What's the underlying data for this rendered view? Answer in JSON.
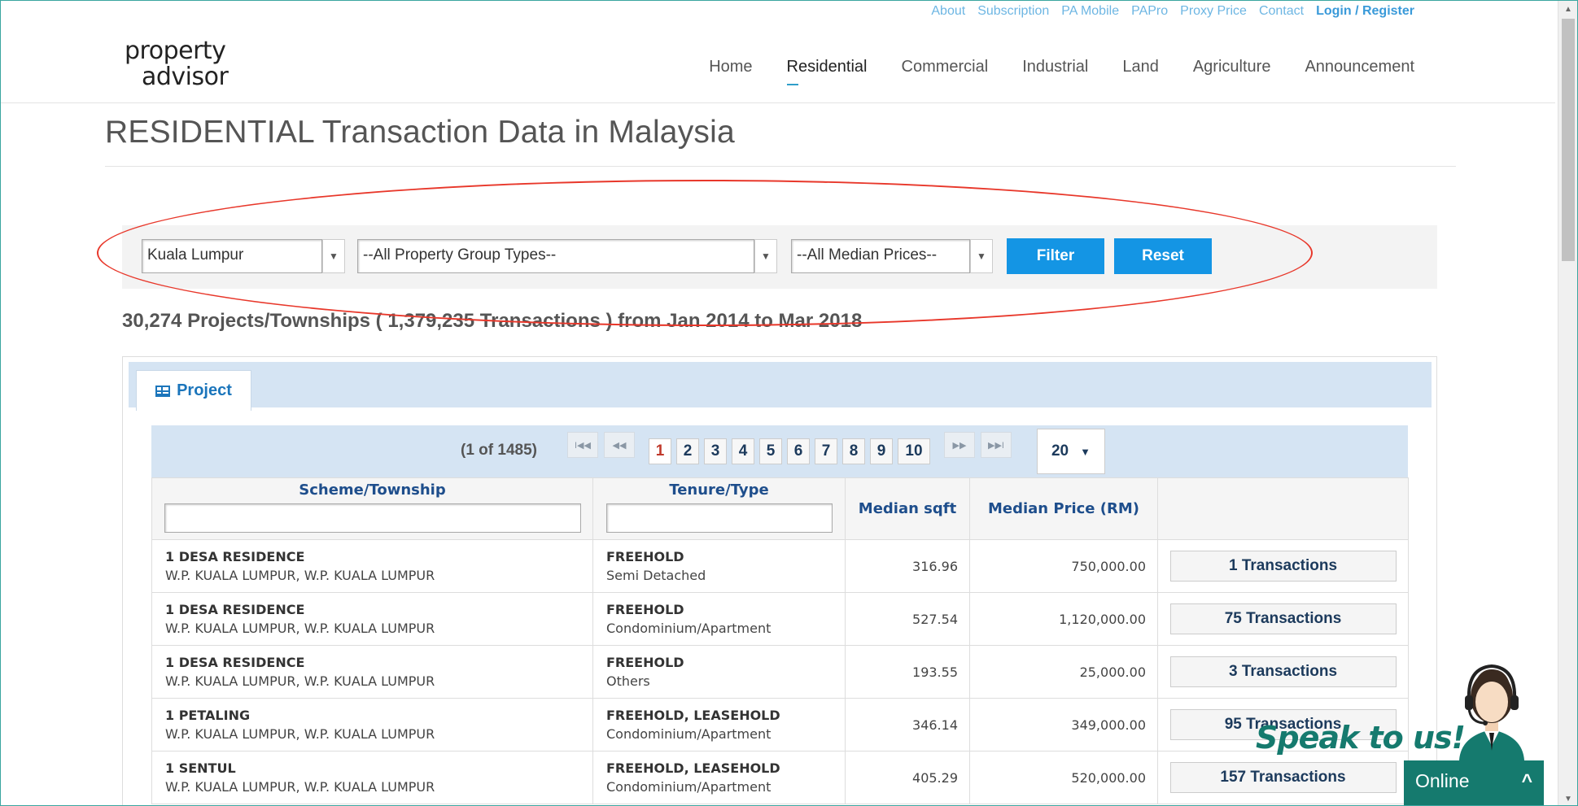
{
  "toplinks": {
    "about": "About",
    "subscription": "Subscription",
    "pa_mobile": "PA Mobile",
    "papro": "PAPro",
    "proxy_price": "Proxy Price",
    "contact": "Contact",
    "login": "Login / Register"
  },
  "logo": {
    "line1": "property",
    "line2": "advisor"
  },
  "nav": {
    "home": "Home",
    "residential": "Residential",
    "commercial": "Commercial",
    "industrial": "Industrial",
    "land": "Land",
    "agriculture": "Agriculture",
    "announcement": "Announcement"
  },
  "page_title": "RESIDENTIAL Transaction Data in Malaysia",
  "filters": {
    "state": "Kuala Lumpur",
    "property_group": "--All Property Group Types--",
    "median_price": "--All Median Prices--",
    "filter_label": "Filter",
    "reset_label": "Reset"
  },
  "summary": "30,274 Projects/Townships ( 1,379,235 Transactions ) from Jan 2014 to Mar 2018",
  "tab": {
    "label": "Project"
  },
  "pager": {
    "info": "(1 of 1485)",
    "first": "I◀◀",
    "prev": "◀◀",
    "next": "▶▶",
    "last": "▶▶I",
    "pages": [
      "1",
      "2",
      "3",
      "4",
      "5",
      "6",
      "7",
      "8",
      "9",
      "10"
    ],
    "current": "1",
    "page_size": "20"
  },
  "columns": {
    "scheme": "Scheme/Township",
    "tenure": "Tenure/Type",
    "sqft": "Median sqft",
    "price": "Median Price (RM)"
  },
  "rows": [
    {
      "name": "1 DESA RESIDENCE",
      "location": "W.P. KUALA LUMPUR, W.P. KUALA LUMPUR",
      "tenure": "FREEHOLD",
      "type": "Semi Detached",
      "sqft": "316.96",
      "price": "750,000.00",
      "tx": "1 Transactions"
    },
    {
      "name": "1 DESA RESIDENCE",
      "location": "W.P. KUALA LUMPUR, W.P. KUALA LUMPUR",
      "tenure": "FREEHOLD",
      "type": "Condominium/Apartment",
      "sqft": "527.54",
      "price": "1,120,000.00",
      "tx": "75 Transactions"
    },
    {
      "name": "1 DESA RESIDENCE",
      "location": "W.P. KUALA LUMPUR, W.P. KUALA LUMPUR",
      "tenure": "FREEHOLD",
      "type": "Others",
      "sqft": "193.55",
      "price": "25,000.00",
      "tx": "3 Transactions"
    },
    {
      "name": "1 PETALING",
      "location": "W.P. KUALA LUMPUR, W.P. KUALA LUMPUR",
      "tenure": "FREEHOLD, LEASEHOLD",
      "type": "Condominium/Apartment",
      "sqft": "346.14",
      "price": "349,000.00",
      "tx": "95 Transactions"
    },
    {
      "name": "1 SENTUL",
      "location": "W.P. KUALA LUMPUR, W.P. KUALA LUMPUR",
      "tenure": "FREEHOLD, LEASEHOLD",
      "type": "Condominium/Apartment",
      "sqft": "405.29",
      "price": "520,000.00",
      "tx": "157 Transactions"
    }
  ],
  "chat": {
    "speak": "Speak to us!",
    "status": "Online",
    "toggle": "^"
  },
  "colors": {
    "accent": "#1495e4",
    "chat": "#157a6e",
    "annotation": "#e8372a",
    "tabbar": "#d5e4f3"
  }
}
